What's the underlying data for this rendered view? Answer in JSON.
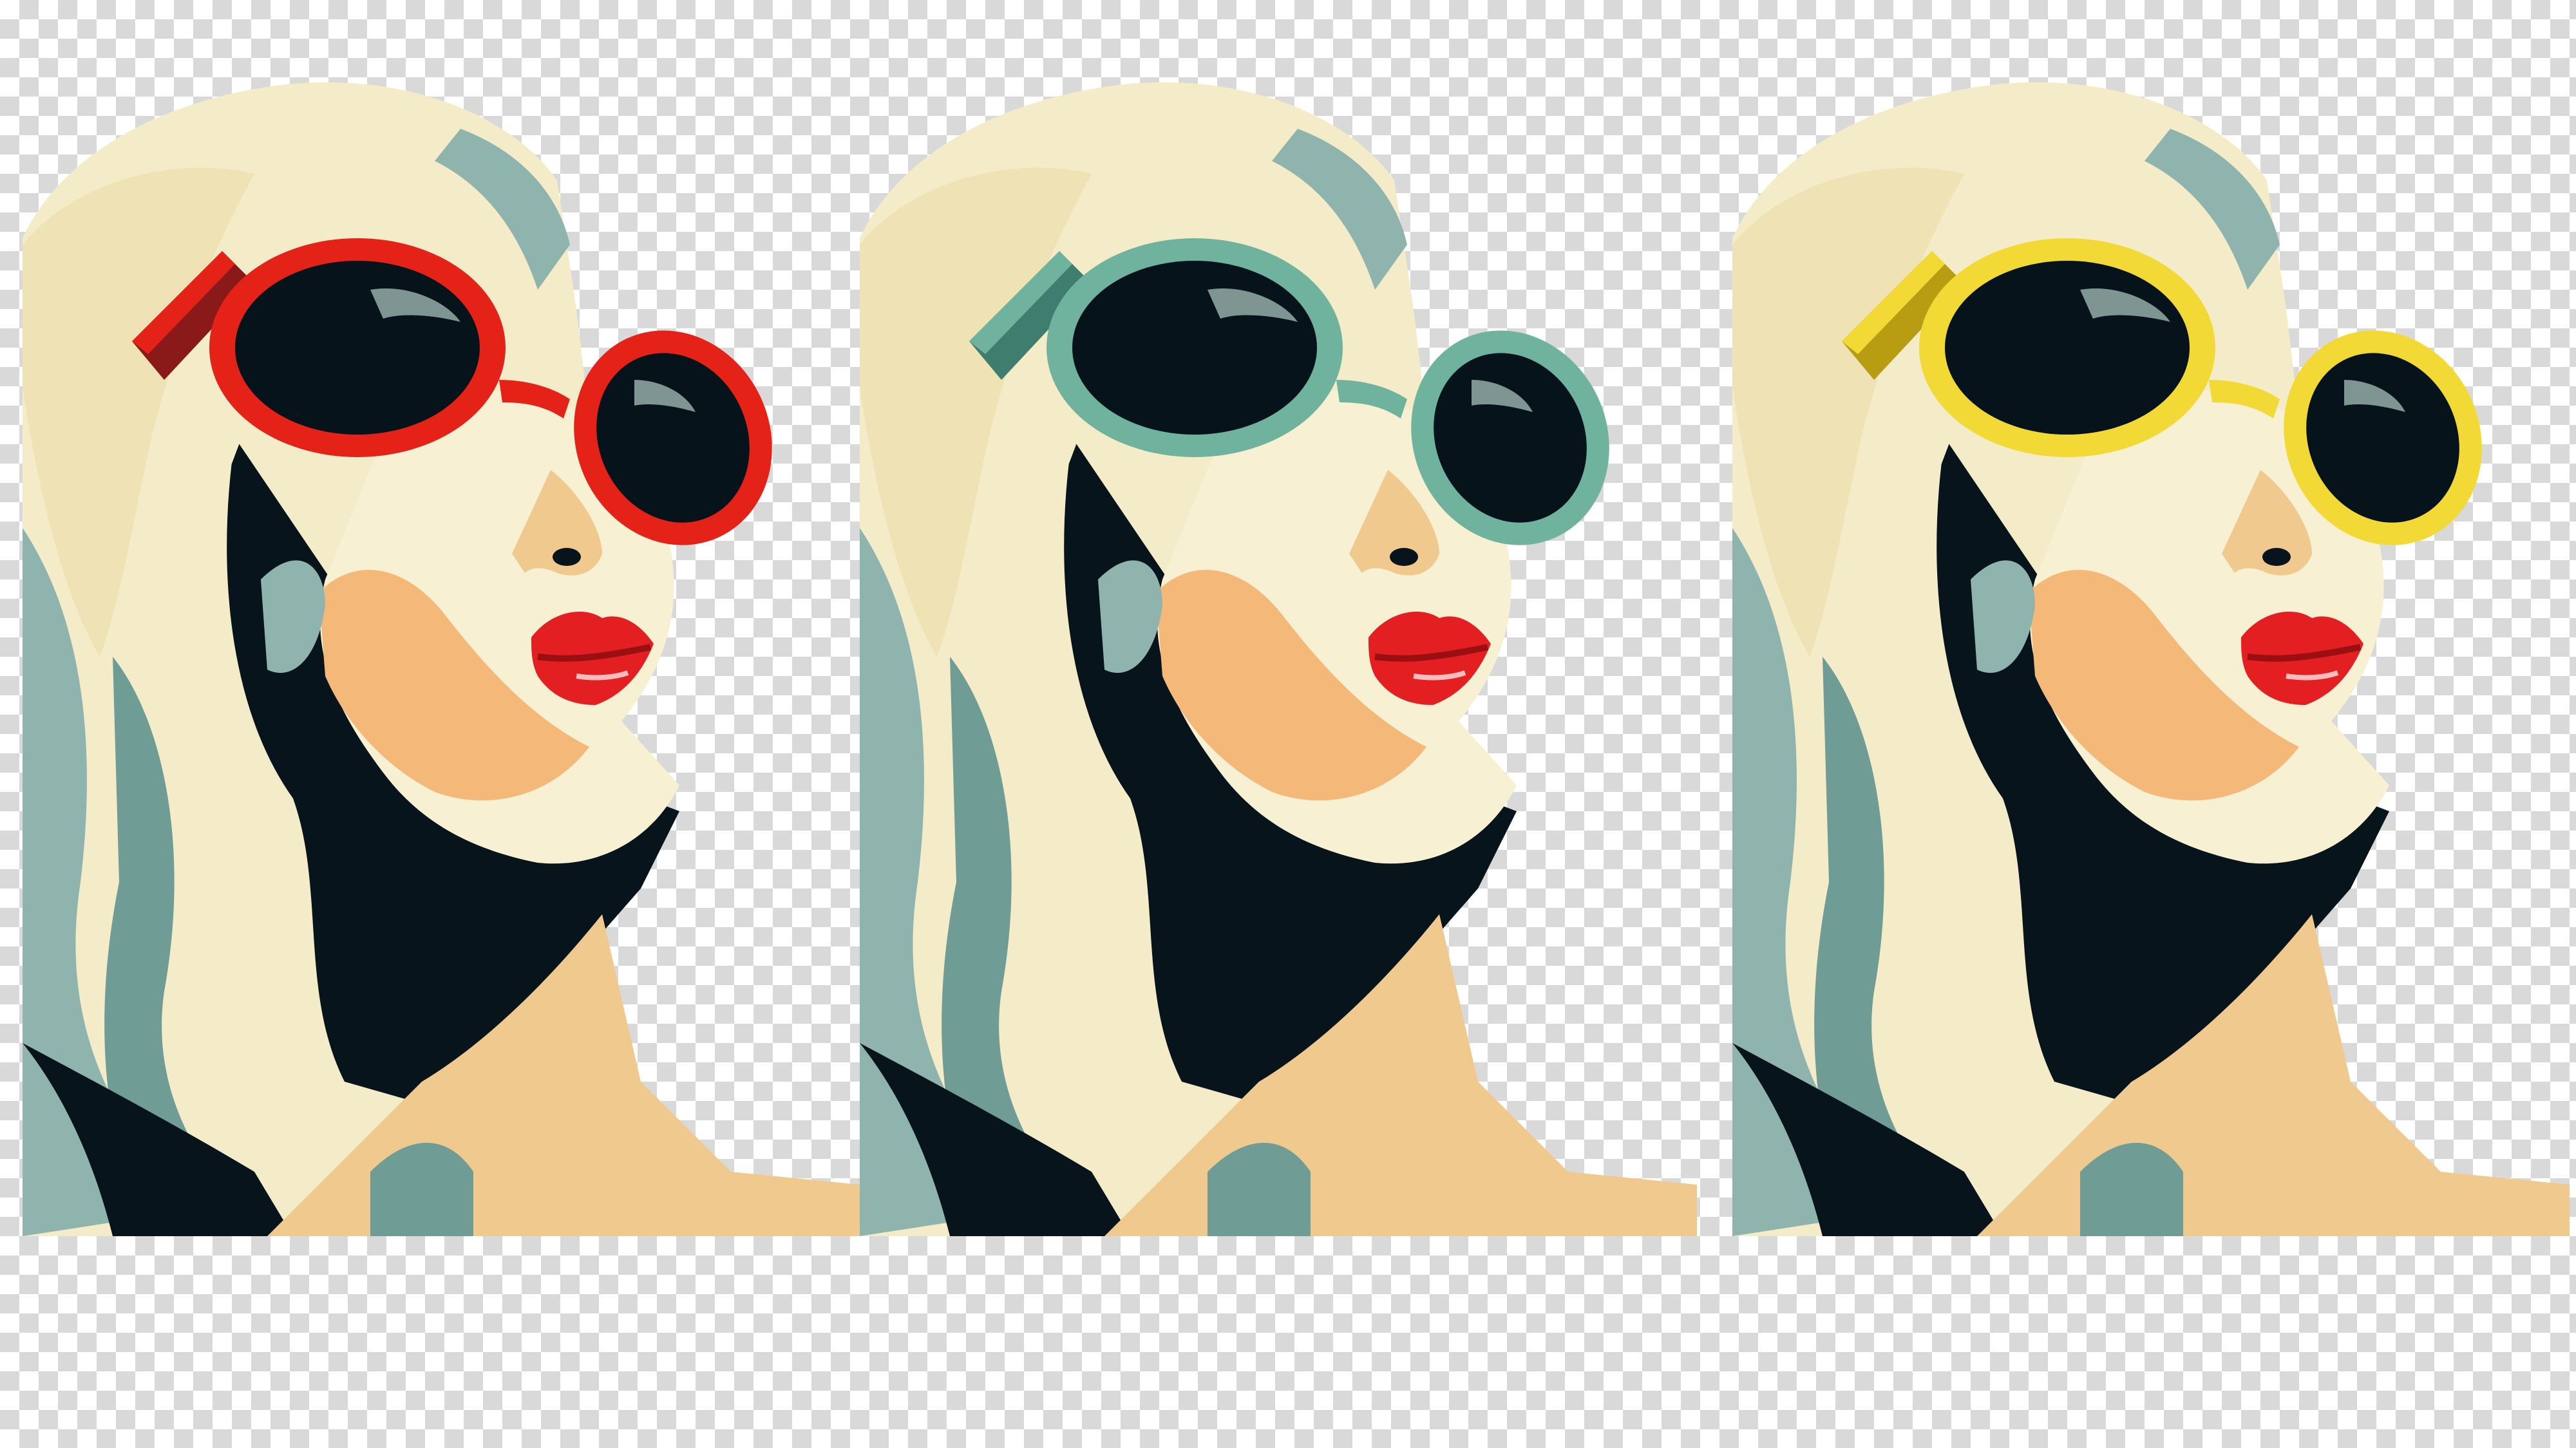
{
  "canvas": {
    "background": "transparency-checkerboard"
  },
  "palette": {
    "hair_light": "#f4ecc8",
    "hair_cream": "#efe3b6",
    "hair_teal": "#8fb4ad",
    "hair_teal_dark": "#6f9c95",
    "skin_light": "#f7f0d2",
    "skin_peach": "#f4b878",
    "skin_warm": "#f0c98e",
    "shadow": "#08141c",
    "lips": "#e41f22",
    "lips_dark": "#9a0f12",
    "lens": "#06131a",
    "lens_highlight": "#7f9591"
  },
  "portraits": [
    {
      "variant": "red-frames",
      "frame_color": "#e52218",
      "frame_shade": "#8a1a1a"
    },
    {
      "variant": "teal-frames",
      "frame_color": "#6fb39e",
      "frame_shade": "#3f7e6f"
    },
    {
      "variant": "yellow-frames",
      "frame_color": "#f2d936",
      "frame_shade": "#b89d12"
    }
  ]
}
